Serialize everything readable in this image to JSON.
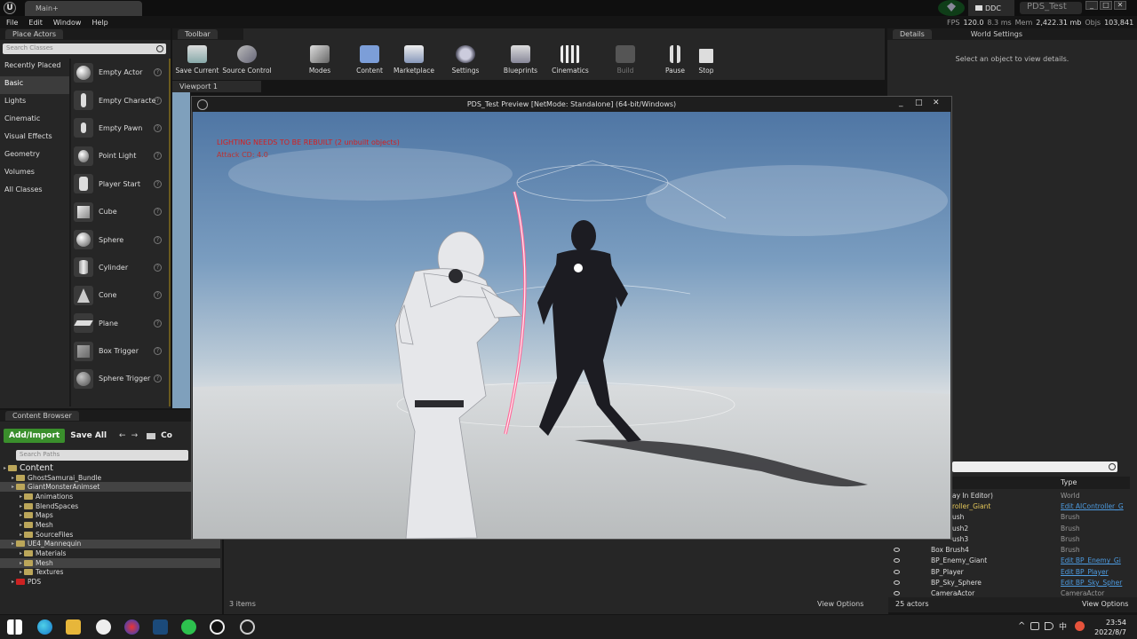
{
  "title_bar": {
    "tab": "Main+",
    "ddc": "DDC",
    "project": "PDS_Test",
    "logo_text": "U"
  },
  "stats": {
    "fps_label": "FPS",
    "fps": "120.0",
    "ms": "8.3 ms",
    "mem_label": "Mem",
    "mem": "2,422.31 mb",
    "objs_label": "Objs",
    "objs": "103,841"
  },
  "menu": [
    "File",
    "Edit",
    "Window",
    "Help"
  ],
  "place_actors": {
    "tab": "Place Actors",
    "search_placeholder": "Search Classes",
    "categories": [
      "Recently Placed",
      "Basic",
      "Lights",
      "Cinematic",
      "Visual Effects",
      "Geometry",
      "Volumes",
      "All Classes"
    ],
    "actors": [
      "Empty Actor",
      "Empty Characte",
      "Empty Pawn",
      "Point Light",
      "Player Start",
      "Cube",
      "Sphere",
      "Cylinder",
      "Cone",
      "Plane",
      "Box Trigger",
      "Sphere Trigger"
    ]
  },
  "toolbar": {
    "tab": "Toolbar",
    "buttons": [
      "Save Current",
      "Source Control",
      "Modes",
      "Content",
      "Marketplace",
      "Settings",
      "Blueprints",
      "Cinematics",
      "Build",
      "Pause",
      "Stop"
    ]
  },
  "viewport": {
    "tab": "Viewport 1"
  },
  "details": {
    "tab": "Details",
    "world_tab": "World Settings",
    "message": "Select an object to view details."
  },
  "preview": {
    "title": "PDS_Test Preview [NetMode: Standalone]  (64-bit/Windows)",
    "warning": "LIGHTING NEEDS TO BE REBUILT (2 unbuilt objects)",
    "debug": "Attack CD: 4.0"
  },
  "content_browser": {
    "tab": "Content Browser",
    "add_import": "Add/Import",
    "save_all": "Save All",
    "search_paths": "Search Paths",
    "path": "Co",
    "tree": [
      {
        "label": "Content",
        "depth": 0,
        "selected": false
      },
      {
        "label": "GhostSamurai_Bundle",
        "depth": 1,
        "selected": false
      },
      {
        "label": "GiantMonsterAnimset",
        "depth": 1,
        "selected": true
      },
      {
        "label": "Animations",
        "depth": 2,
        "selected": false
      },
      {
        "label": "BlendSpaces",
        "depth": 2,
        "selected": false
      },
      {
        "label": "Maps",
        "depth": 2,
        "selected": false
      },
      {
        "label": "Mesh",
        "depth": 2,
        "selected": false
      },
      {
        "label": "SourceFiles",
        "depth": 2,
        "selected": false
      },
      {
        "label": "UE4_Mannequin",
        "depth": 1,
        "selected": true
      },
      {
        "label": "Materials",
        "depth": 2,
        "selected": false
      },
      {
        "label": "Mesh",
        "depth": 2,
        "selected": true
      },
      {
        "label": "Textures",
        "depth": 2,
        "selected": false
      },
      {
        "label": "PDS",
        "depth": 1,
        "selected": false
      }
    ],
    "items": "3 items",
    "view_options": "View Options"
  },
  "outliner": {
    "type_header": "Type",
    "rows": [
      {
        "name": "ay In Editor)",
        "type": "World",
        "link": false
      },
      {
        "name": "roller_Giant",
        "type": "Edit AIController_G",
        "link": true
      },
      {
        "name": "ush",
        "type": "Brush",
        "link": false
      },
      {
        "name": "ush2",
        "type": "Brush",
        "link": false
      },
      {
        "name": "ush3",
        "type": "Brush",
        "link": false
      },
      {
        "name": "Box Brush4",
        "type": "Brush",
        "link": false
      },
      {
        "name": "BP_Enemy_Giant",
        "type": "Edit BP_Enemy_Gi",
        "link": true
      },
      {
        "name": "BP_Player",
        "type": "Edit BP_Player",
        "link": true
      },
      {
        "name": "BP_Sky_Sphere",
        "type": "Edit BP_Sky_Spher",
        "link": true
      },
      {
        "name": "CameraActor",
        "type": "CameraActor",
        "link": false
      }
    ],
    "count": "25 actors",
    "view_options": "View Options"
  },
  "taskbar": {
    "time": "23:54",
    "date": "2022/8/7",
    "ime": "中"
  }
}
